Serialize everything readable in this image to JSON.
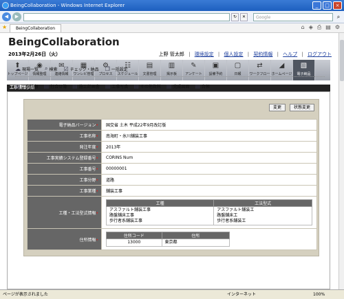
{
  "window": {
    "title": "BeingCollaboration - Windows Internet Explorer",
    "minimize": "_",
    "maximize": "□",
    "close": "×"
  },
  "browser": {
    "address": "",
    "search_placeholder": "Google",
    "back": "◀",
    "forward": "▶",
    "refresh": "↻",
    "stop": "✕",
    "search_go": "⌕",
    "tab_label": "BeingCollaboration"
  },
  "header": {
    "brand": "BeingCollaboration",
    "date": "2013年2月26日（火）",
    "user": "上野 管太郎",
    "links": [
      "環境設定",
      "個人設定",
      "契約情報",
      "ヘルプ",
      "ログアウト"
    ]
  },
  "menu": [
    {
      "icon": "⬆",
      "label": "トップページ"
    },
    {
      "icon": "◉",
      "label": "情報整理"
    },
    {
      "icon": "✉",
      "label": "連絡情報"
    },
    {
      "icon": "▦",
      "label": "ワンレビ管理"
    },
    {
      "icon": "⚙",
      "label": "プロセス"
    },
    {
      "icon": "☷",
      "label": "スケジュール"
    },
    {
      "icon": "▤",
      "label": "文書管理"
    },
    {
      "icon": "▥",
      "label": "掲示板"
    },
    {
      "icon": "✎",
      "label": "アンケート"
    },
    {
      "icon": "▣",
      "label": "設備予約"
    },
    {
      "icon": "▢",
      "label": "日報"
    },
    {
      "icon": "⇄",
      "label": "ワークフロー"
    },
    {
      "icon": "◢",
      "label": "ホームページ"
    },
    {
      "icon": "▧",
      "label": "電子納品"
    }
  ],
  "section": {
    "title": "工事情報参照"
  },
  "row1": [
    {
      "icon": "☁",
      "label": "現場一覧"
    },
    {
      "icon": "⌕",
      "label": "検索"
    },
    {
      "icon": "☑",
      "label": "チェック・納品"
    },
    {
      "icon": "❐",
      "label": "一括設定"
    }
  ],
  "row2": [
    {
      "icon": "▤",
      "label": "工事情報"
    },
    {
      "icon": "▤",
      "label": "打合せ簿"
    },
    {
      "icon": "▤",
      "label": "施工計画書"
    },
    {
      "icon": "▤",
      "label": "工事写真"
    },
    {
      "icon": "▤",
      "label": "その他資料"
    },
    {
      "icon": "▤",
      "label": "完成図面"
    },
    {
      "icon": "▤",
      "label": "台帳"
    }
  ],
  "buttons": {
    "change": "変更",
    "status_change": "状態変更"
  },
  "fields": [
    {
      "label": "電子納品バージョン",
      "value": "国交省 土木 平成22年9月改訂版"
    },
    {
      "label": "工事名称",
      "value": "南海町・氷川舗装工事"
    },
    {
      "label": "発注年度",
      "value": "2013年"
    },
    {
      "label": "工事実績システム登録番号",
      "value": "CORINS Num"
    },
    {
      "label": "工事番号",
      "value": "00000001"
    },
    {
      "label": "工事分野",
      "value": "道路"
    },
    {
      "label": "工事業種",
      "value": "舗装工事"
    }
  ],
  "koshu": {
    "label": "工種・工法型式情報",
    "head": [
      "工種",
      "工法型式"
    ],
    "col1": [
      "アスファルト舗装工事",
      "路盤舗床工事",
      "歩行者系舗装工事"
    ],
    "col2": [
      "アスファルト舗装工",
      "路盤舗床工",
      "歩行者系舗装工"
    ]
  },
  "address": {
    "label": "住所情報",
    "head": [
      "住所コード",
      "住所"
    ],
    "code": "13000",
    "name": "東京都"
  },
  "status": {
    "text": "ページが表示されました",
    "zone": "インターネット",
    "zoom": "100%"
  }
}
